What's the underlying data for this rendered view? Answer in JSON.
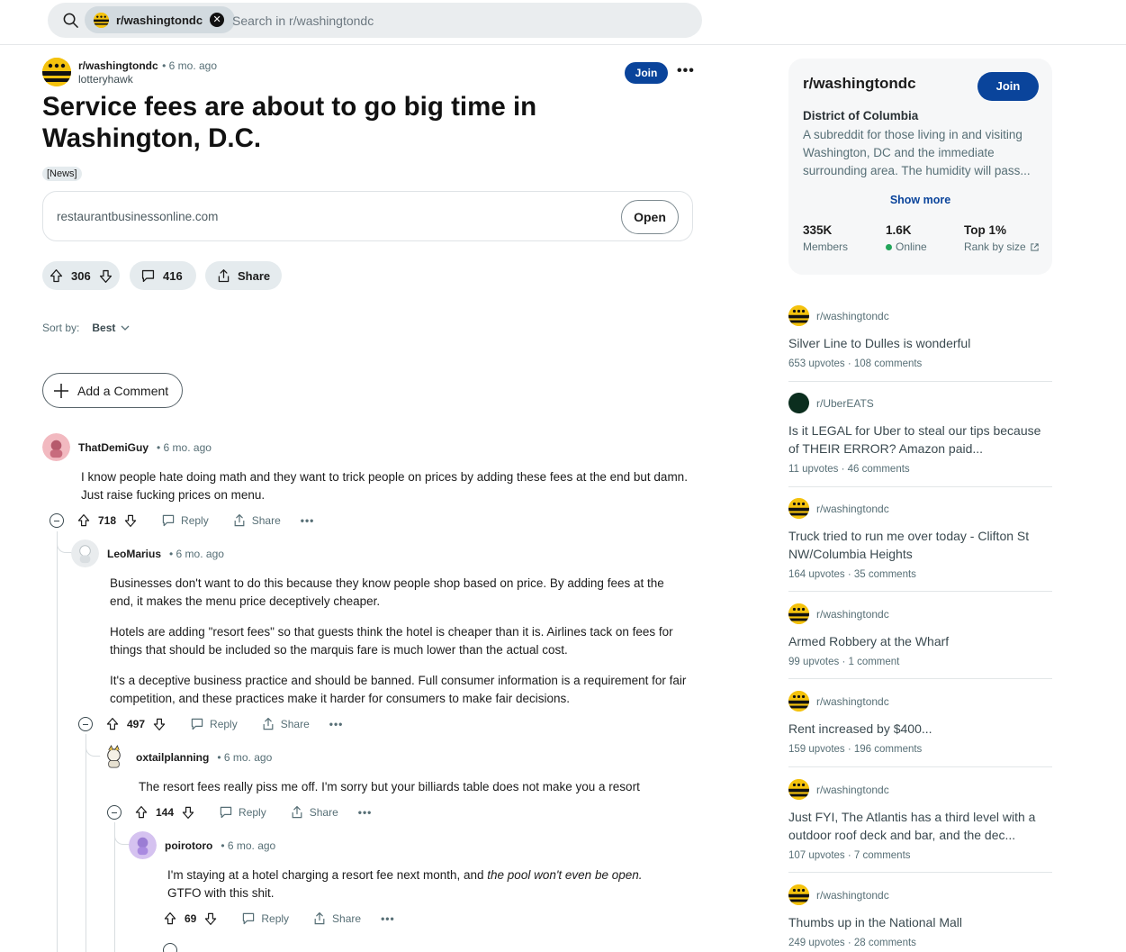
{
  "search": {
    "chip_label": "r/washingtondc",
    "placeholder": "Search in r/washingtondc"
  },
  "post": {
    "subreddit": "r/washingtondc",
    "time": "• 6 mo. ago",
    "author": "lotteryhawk",
    "join_label": "Join",
    "more_label": "•••",
    "title": "Service fees are about to go big time in Washington, D.C.",
    "flair": "[News]",
    "link_domain": "restaurantbusinessonline.com",
    "open_label": "Open",
    "score": "306",
    "comments_count": "416",
    "share_label": "Share"
  },
  "sort": {
    "label": "Sort by:",
    "value": "Best"
  },
  "add_comment_label": "Add a Comment",
  "comments": [
    {
      "user": "ThatDemiGuy",
      "time": "• 6 mo. ago",
      "body": [
        "I know people hate doing math and they want to trick people on prices by adding these fees at the end but damn. Just raise fucking prices on menu."
      ],
      "score": "718",
      "reply": "Reply",
      "share": "Share",
      "more": "•••"
    },
    {
      "user": "LeoMarius",
      "time": "• 6 mo. ago",
      "body": [
        "Businesses don't want to do this because they know people shop based on price. By adding fees at the end, it makes the menu price deceptively cheaper.",
        "Hotels are adding \"resort fees\" so that guests think the hotel is cheaper than it is. Airlines tack on fees for things that should be included so the marquis fare is much lower than the actual cost.",
        "It's a deceptive business practice and should be banned. Full consumer information is a requirement for fair competition, and these practices make it harder for consumers to make fair decisions."
      ],
      "score": "497",
      "reply": "Reply",
      "share": "Share",
      "more": "•••"
    },
    {
      "user": "oxtailplanning",
      "time": "• 6 mo. ago",
      "body": [
        "The resort fees really piss me off. I'm sorry but your billiards table does not make you a resort"
      ],
      "score": "144",
      "reply": "Reply",
      "share": "Share",
      "more": "•••"
    },
    {
      "user": "poirotoro",
      "time": "• 6 mo. ago",
      "body_plain": "I'm staying at a hotel charging a resort fee next month, and ",
      "body_em": "the pool won't even be open.",
      "body_after": "GTFO with this shit.",
      "score": "69",
      "reply": "Reply",
      "share": "Share",
      "more": "•••"
    }
  ],
  "sidebar": {
    "title": "r/washingtondc",
    "join_label": "Join",
    "subtitle": "District of Columbia",
    "description": "A subreddit for those living in and visiting Washington, DC and the immediate surrounding area. The humidity will pass...",
    "show_more": "Show more",
    "stats": [
      {
        "value": "335K",
        "label": "Members"
      },
      {
        "value": "1.6K",
        "label": "Online"
      },
      {
        "value": "Top 1%",
        "label": "Rank by size"
      }
    ],
    "related": [
      {
        "sub": "r/washingtondc",
        "title": "Silver Line to Dulles is wonderful",
        "meta": "653 upvotes · 108 comments",
        "avatar": "dc"
      },
      {
        "sub": "r/UberEATS",
        "title": "Is it LEGAL for Uber to steal our tips because of THEIR ERROR? Amazon paid...",
        "meta": "11 upvotes · 46 comments",
        "avatar": "uber"
      },
      {
        "sub": "r/washingtondc",
        "title": "Truck tried to run me over today - Clifton St NW/Columbia Heights",
        "meta": "164 upvotes · 35 comments",
        "avatar": "dc"
      },
      {
        "sub": "r/washingtondc",
        "title": "Armed Robbery at the Wharf",
        "meta": "99 upvotes · 1 comment",
        "avatar": "dc"
      },
      {
        "sub": "r/washingtondc",
        "title": "Rent increased by $400...",
        "meta": "159 upvotes · 196 comments",
        "avatar": "dc"
      },
      {
        "sub": "r/washingtondc",
        "title": "Just FYI, The Atlantis has a third level with a outdoor roof deck and bar, and the dec...",
        "meta": "107 upvotes · 7 comments",
        "avatar": "dc"
      },
      {
        "sub": "r/washingtondc",
        "title": "Thumbs up in the National Mall",
        "meta": "249 upvotes · 28 comments",
        "avatar": "dc"
      }
    ]
  },
  "colors": {
    "accent": "#0a449b",
    "pill_bg": "#e5ebee",
    "online": "#22a55a"
  }
}
